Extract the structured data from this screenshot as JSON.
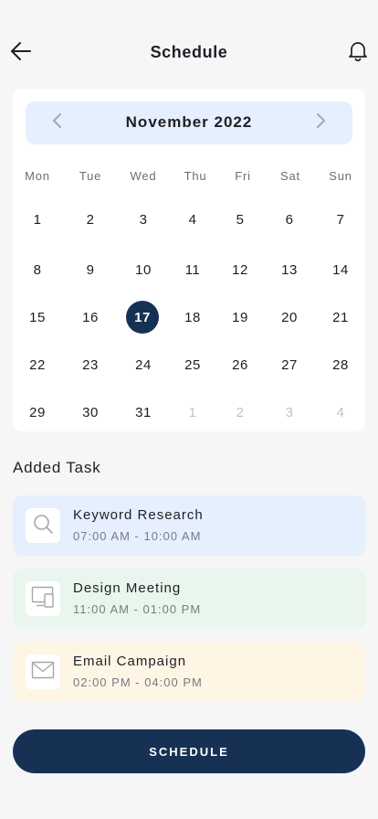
{
  "header": {
    "title": "Schedule",
    "back_icon": "arrow-left-icon",
    "notification_icon": "bell-icon"
  },
  "calendar": {
    "month_label": "November 2022",
    "prev_icon": "chevron-left-icon",
    "next_icon": "chevron-right-icon",
    "weekdays": [
      "Mon",
      "Tue",
      "Wed",
      "Thu",
      "Fri",
      "Sat",
      "Sun"
    ],
    "weeks": [
      [
        "1",
        "2",
        "3",
        "4",
        "5",
        "6",
        "7"
      ],
      [
        "8",
        "9",
        "10",
        "11",
        "12",
        "13",
        "14"
      ],
      [
        "15",
        "16",
        "17",
        "18",
        "19",
        "20",
        "21"
      ],
      [
        "22",
        "23",
        "24",
        "25",
        "26",
        "27",
        "28"
      ],
      [
        "29",
        "30",
        "31",
        "1",
        "2",
        "3",
        "4"
      ]
    ],
    "selected_day": "17"
  },
  "tasks_section": {
    "title": "Added Task",
    "items": [
      {
        "title": "Keyword Research",
        "time": "07:00 AM - 10:00 AM",
        "icon": "search-icon",
        "bg_color": "#e5effd"
      },
      {
        "title": "Design Meeting",
        "time": "11:00 AM - 01:00 PM",
        "icon": "devices-icon",
        "bg_color": "#e9f6ee"
      },
      {
        "title": "Email Campaign",
        "time": "02:00 PM - 04:00 PM",
        "icon": "mail-icon",
        "bg_color": "#fff5e5"
      }
    ]
  },
  "schedule_button": {
    "label": "SCHEDULE"
  },
  "colors": {
    "primary": "#173154",
    "background": "#f6f6f7",
    "muted_day": "#c2c3c8"
  }
}
